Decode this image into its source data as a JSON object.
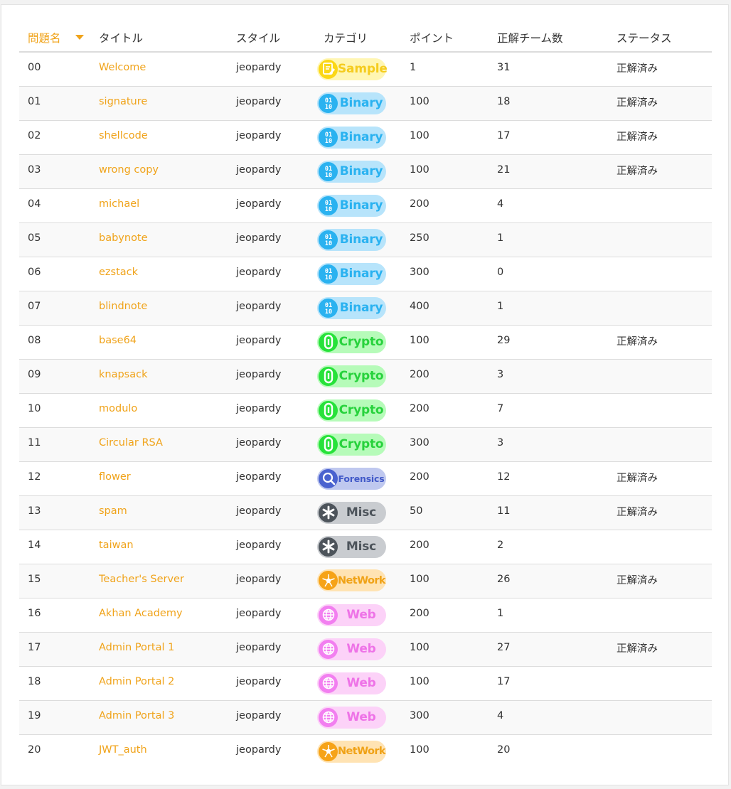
{
  "colors": {
    "accent": "#f0a31a",
    "text": "#333333",
    "row_alt": "#f9f9f9",
    "divider": "#dcdcdc"
  },
  "table": {
    "headers": {
      "id": "問題名",
      "title": "タイトル",
      "style": "スタイル",
      "category": "カテゴリ",
      "points": "ポイント",
      "solves": "正解チーム数",
      "status": "ステータス"
    },
    "sort": {
      "column": "id",
      "direction": "desc-caret"
    },
    "rows": [
      {
        "id": "00",
        "title": "Welcome",
        "style": "jeopardy",
        "category": "Sample",
        "points": "1",
        "solves": "31",
        "status": "正解済み"
      },
      {
        "id": "01",
        "title": "signature",
        "style": "jeopardy",
        "category": "Binary",
        "points": "100",
        "solves": "18",
        "status": "正解済み"
      },
      {
        "id": "02",
        "title": "shellcode",
        "style": "jeopardy",
        "category": "Binary",
        "points": "100",
        "solves": "17",
        "status": "正解済み"
      },
      {
        "id": "03",
        "title": "wrong copy",
        "style": "jeopardy",
        "category": "Binary",
        "points": "100",
        "solves": "21",
        "status": "正解済み"
      },
      {
        "id": "04",
        "title": "michael",
        "style": "jeopardy",
        "category": "Binary",
        "points": "200",
        "solves": "4",
        "status": ""
      },
      {
        "id": "05",
        "title": "babynote",
        "style": "jeopardy",
        "category": "Binary",
        "points": "250",
        "solves": "1",
        "status": ""
      },
      {
        "id": "06",
        "title": "ezstack",
        "style": "jeopardy",
        "category": "Binary",
        "points": "300",
        "solves": "0",
        "status": ""
      },
      {
        "id": "07",
        "title": "blindnote",
        "style": "jeopardy",
        "category": "Binary",
        "points": "400",
        "solves": "1",
        "status": ""
      },
      {
        "id": "08",
        "title": "base64",
        "style": "jeopardy",
        "category": "Crypto",
        "points": "100",
        "solves": "29",
        "status": "正解済み"
      },
      {
        "id": "09",
        "title": "knapsack",
        "style": "jeopardy",
        "category": "Crypto",
        "points": "200",
        "solves": "3",
        "status": ""
      },
      {
        "id": "10",
        "title": "modulo",
        "style": "jeopardy",
        "category": "Crypto",
        "points": "200",
        "solves": "7",
        "status": ""
      },
      {
        "id": "11",
        "title": "Circular RSA",
        "style": "jeopardy",
        "category": "Crypto",
        "points": "300",
        "solves": "3",
        "status": ""
      },
      {
        "id": "12",
        "title": "flower",
        "style": "jeopardy",
        "category": "Forensics",
        "points": "200",
        "solves": "12",
        "status": "正解済み"
      },
      {
        "id": "13",
        "title": "spam",
        "style": "jeopardy",
        "category": "Misc",
        "points": "50",
        "solves": "11",
        "status": "正解済み"
      },
      {
        "id": "14",
        "title": "taiwan",
        "style": "jeopardy",
        "category": "Misc",
        "points": "200",
        "solves": "2",
        "status": ""
      },
      {
        "id": "15",
        "title": "Teacher's Server",
        "style": "jeopardy",
        "category": "NetWork",
        "points": "100",
        "solves": "26",
        "status": "正解済み"
      },
      {
        "id": "16",
        "title": "Akhan Academy",
        "style": "jeopardy",
        "category": "Web",
        "points": "200",
        "solves": "1",
        "status": ""
      },
      {
        "id": "17",
        "title": "Admin Portal 1",
        "style": "jeopardy",
        "category": "Web",
        "points": "100",
        "solves": "27",
        "status": "正解済み"
      },
      {
        "id": "18",
        "title": "Admin Portal 2",
        "style": "jeopardy",
        "category": "Web",
        "points": "100",
        "solves": "17",
        "status": ""
      },
      {
        "id": "19",
        "title": "Admin Portal 3",
        "style": "jeopardy",
        "category": "Web",
        "points": "300",
        "solves": "4",
        "status": ""
      },
      {
        "id": "20",
        "title": "JWT_auth",
        "style": "jeopardy",
        "category": "NetWork",
        "points": "100",
        "solves": "20",
        "status": ""
      }
    ]
  },
  "categories": {
    "Sample": {
      "icon": "memo-icon",
      "bg": "#fff6b3",
      "fg": "#f5cc1e",
      "icon_bg": "#fbd716"
    },
    "Binary": {
      "icon": "binary-icon",
      "bg": "#b7e4fb",
      "fg": "#2ab2f0",
      "icon_bg": "#2ab2f0"
    },
    "Crypto": {
      "icon": "chain-icon",
      "bg": "#b6fbb9",
      "fg": "#27d23c",
      "icon_bg": "#27e23a"
    },
    "Forensics": {
      "icon": "magnifier-icon",
      "bg": "#bfc8ef",
      "fg": "#4159c8",
      "icon_bg": "#4a62cf"
    },
    "Misc": {
      "icon": "asterisk-icon",
      "bg": "#c9ccd0",
      "fg": "#4d545b",
      "icon_bg": "#4d545b"
    },
    "NetWork": {
      "icon": "network-icon",
      "bg": "#ffe3b3",
      "fg": "#f0a216",
      "icon_bg": "#f6a317"
    },
    "Web": {
      "icon": "globe-icon",
      "bg": "#fcd2f8",
      "fg": "#ee73e7",
      "icon_bg": "#f27ff0"
    }
  }
}
